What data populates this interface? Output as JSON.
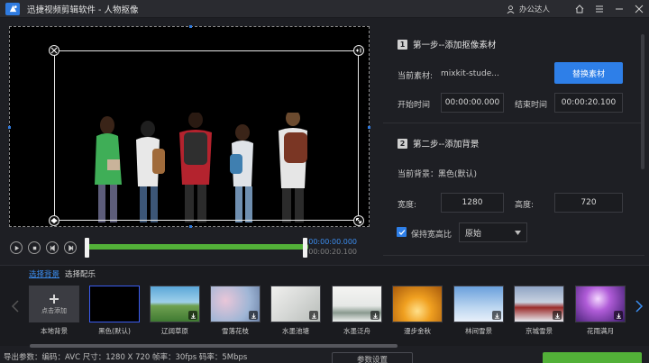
{
  "window": {
    "title": "迅捷视频剪辑软件 - 人物抠像",
    "user": "办公达人"
  },
  "playback": {
    "current_time": "00:00:00.000",
    "total_time": "00:00:20.100"
  },
  "step1": {
    "heading_num": "1",
    "heading": "第一步--添加抠像素材",
    "material_label": "当前素材:",
    "material_value": "mixkit-stude...",
    "replace_button": "替换素材",
    "start_label": "开始时间",
    "start_value": "00:00:00.000",
    "end_label": "结束时间",
    "end_value": "00:00:20.100"
  },
  "step2": {
    "heading_num": "2",
    "heading": "第二步--添加背景",
    "bg_label": "当前背景：黑色(默认)",
    "width_label": "宽度:",
    "width_value": "1280",
    "height_label": "高度:",
    "height_value": "720",
    "keep_ratio_label": "保持宽高比",
    "ratio_option": "原始"
  },
  "library": {
    "tab_background": "选择背景",
    "tab_music": "选择配乐",
    "add_label": "点击添加",
    "items": [
      {
        "caption": "本地背景"
      },
      {
        "caption": "黑色(默认)"
      },
      {
        "caption": "辽阔草原"
      },
      {
        "caption": "雪落花枝"
      },
      {
        "caption": "水墨池塘"
      },
      {
        "caption": "水墨泛舟"
      },
      {
        "caption": "漫步金秋"
      },
      {
        "caption": "林间雪景"
      },
      {
        "caption": "京城雪景"
      },
      {
        "caption": "花雨满月"
      }
    ]
  },
  "footer": {
    "info": "导出参数：编码：AVC    尺寸：1280 X 720    帧率：30fps    码率：5Mbps",
    "param_button": "参数设置"
  },
  "colors": {
    "accent": "#2e7fe8",
    "progress": "#52b038"
  }
}
